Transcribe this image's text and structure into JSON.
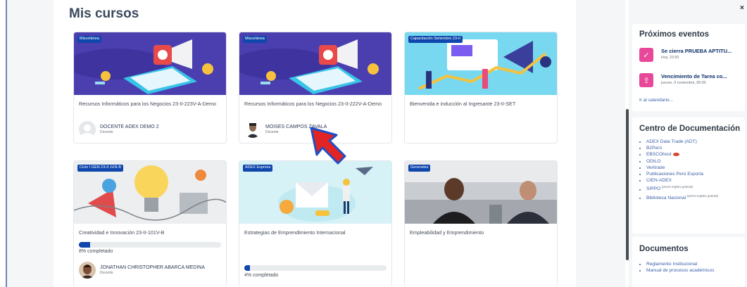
{
  "page": {
    "title": "Mis cursos"
  },
  "courses": [
    {
      "badge": "Miscelánea",
      "title": "Recursos Informáticos para los Negocios 23-II-223V-A-Demo",
      "teacher": "DOCENTE ADEX DEMO 2",
      "role": "Docente"
    },
    {
      "badge": "Miscelánea",
      "title": "Recursos Informáticos para los Negocios 23-II-222V-A-Demo",
      "teacher": "MOISES CAMPOS ZAVALA",
      "role": "Docente"
    },
    {
      "badge": "Capacitación Setiembre 23-II",
      "title": "Bienvenida e inducción al Ingresante 23-II-SET"
    },
    {
      "badge": "Ciclo I GEN 23-II JUN-B",
      "title": "Creatividad e Innovación 23-II-101V-B",
      "progress": 8,
      "progress_label": "8% completado",
      "teacher": "JONATHAN CHRISTOPHER ABARCA MEDINA",
      "role": "Docente"
    },
    {
      "badge": "ADEX Express",
      "title": "Estrategias de Emprendimiento Internacional",
      "progress": 4,
      "progress_label": "4% completado"
    },
    {
      "badge": "Generales",
      "title": "Empleabilidad y Emprendimiento"
    }
  ],
  "events_block": {
    "title": "Próximos eventos",
    "events": [
      {
        "icon": "check-icon",
        "title": "Se cierra PRUEBA APTITU...",
        "time": "Hoy, 23:59"
      },
      {
        "icon": "upload-icon",
        "title": "Vencimiento de Tarea co...",
        "time": "jueves, 9 noviembre, 00:00"
      }
    ],
    "calendar_link": "Ir al calendario..."
  },
  "doc_center": {
    "title": "Centro de Documentación",
    "items": [
      "ADEX Data Trade (ADT)",
      "B2Perú",
      "EBSCOhost",
      "ODILO",
      "Veritrade",
      "Publicaciones Perú Exporta",
      "CIEN-ADEX",
      "SIPPO",
      "Biblioteca Nacional"
    ],
    "note": "(previo registro gratuito)"
  },
  "documents": {
    "title": "Documentos",
    "items": [
      "Reglamento Institucional",
      "Manual de procesos académicos"
    ]
  },
  "colors": {
    "accent": "#0f47ad",
    "event": "#e8489a",
    "arrow": "#e32424"
  }
}
